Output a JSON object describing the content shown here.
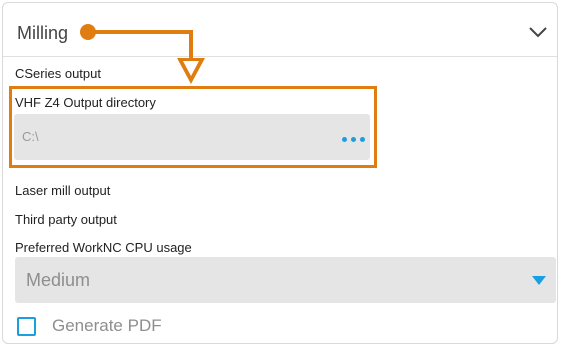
{
  "header": {
    "title": "Milling"
  },
  "sections": {
    "cseries_label": "CSeries output",
    "vhf_label": "VHF Z4 Output directory",
    "vhf_value": "C:\\",
    "laser_label": "Laser mill output",
    "third_party_label": "Third party output",
    "cpu_label": "Preferred WorkNC CPU usage",
    "cpu_value": "Medium",
    "generate_pdf_label": "Generate PDF"
  },
  "colors": {
    "accent": "#1b9fe0",
    "callout": "#e07d10",
    "field_bg": "#e5e5e5"
  },
  "icons": {
    "header_chevron": "chevron-down-icon",
    "browse": "more-horizontal-icon",
    "select_caret": "caret-down-icon"
  }
}
